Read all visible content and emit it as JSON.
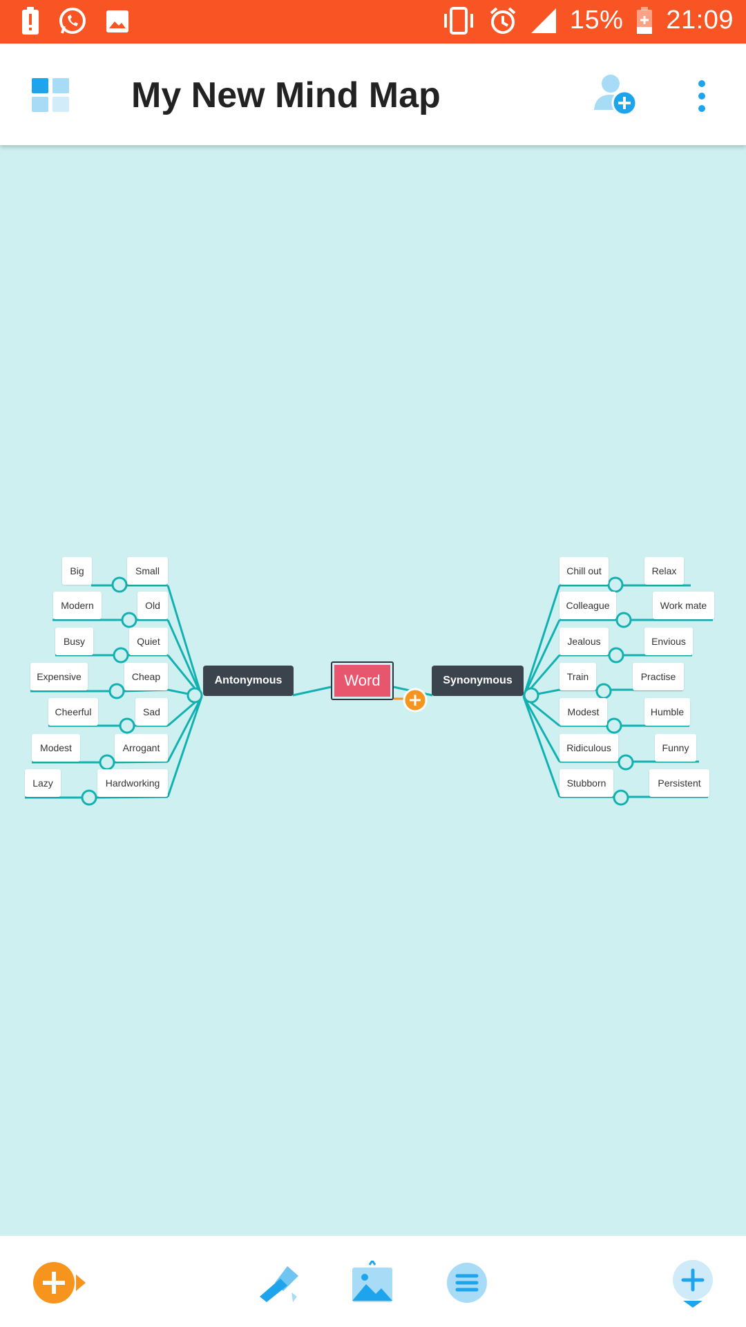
{
  "status_bar": {
    "battery_percent": "15%",
    "time": "21:09",
    "left_icons": [
      "battery-alert-icon",
      "whatsapp-icon",
      "image-icon"
    ],
    "right_icons": [
      "vibrate-icon",
      "alarm-icon",
      "signal-icon",
      "battery-charging-icon"
    ]
  },
  "app_bar": {
    "title": "My New Mind Map",
    "icons": [
      "grid-menu-icon",
      "add-person-icon",
      "more-vertical-icon"
    ]
  },
  "mind_map": {
    "central": "Word",
    "left_branch": {
      "label": "Antonymous",
      "pairs": [
        {
          "outer": "Big",
          "inner": "Small"
        },
        {
          "outer": "Modern",
          "inner": "Old"
        },
        {
          "outer": "Busy",
          "inner": "Quiet"
        },
        {
          "outer": "Expensive",
          "inner": "Cheap"
        },
        {
          "outer": "Cheerful",
          "inner": "Sad"
        },
        {
          "outer": "Modest",
          "inner": "Arrogant"
        },
        {
          "outer": "Lazy",
          "inner": "Hardworking"
        }
      ]
    },
    "right_branch": {
      "label": "Synonymous",
      "pairs": [
        {
          "inner": "Chill out",
          "outer": "Relax"
        },
        {
          "inner": "Colleague",
          "outer": "Work mate"
        },
        {
          "inner": "Jealous",
          "outer": "Envious"
        },
        {
          "inner": "Train",
          "outer": "Practise"
        },
        {
          "inner": "Modest",
          "outer": "Humble"
        },
        {
          "inner": "Ridiculous",
          "outer": "Funny"
        },
        {
          "inner": "Stubborn",
          "outer": "Persistent"
        }
      ]
    }
  },
  "bottom_bar": {
    "icons": [
      "add-topic-icon",
      "paint-brush-icon",
      "insert-image-icon",
      "outline-list-icon",
      "add-floating-icon"
    ]
  },
  "colors": {
    "status_bar": "#f85424",
    "canvas": "#cef0f0",
    "connector": "#12b0b0",
    "accent_blue": "#1ea4ec",
    "accent_orange": "#f7941d",
    "central_node": "#e8566e",
    "branch_node": "#3b444d"
  }
}
